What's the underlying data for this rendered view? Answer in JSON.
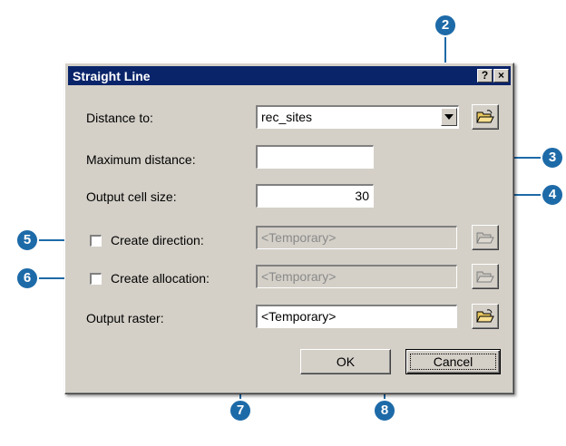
{
  "dialog": {
    "title": "Straight Line",
    "help_button": "?",
    "close_button": "×"
  },
  "form": {
    "distance_to": {
      "label": "Distance to:",
      "value": "rec_sites"
    },
    "max_distance": {
      "label": "Maximum distance:",
      "value": ""
    },
    "cell_size": {
      "label": "Output cell size:",
      "value": "30"
    },
    "create_direction": {
      "label": "Create direction:",
      "checked": false,
      "value": "<Temporary>"
    },
    "create_allocation": {
      "label": "Create allocation:",
      "checked": false,
      "value": "<Temporary>"
    },
    "output_raster": {
      "label": "Output raster:",
      "value": "<Temporary>"
    }
  },
  "buttons": {
    "ok": "OK",
    "cancel": "Cancel"
  },
  "callouts": [
    "2",
    "3",
    "4",
    "5",
    "6",
    "7",
    "8"
  ],
  "colors": {
    "titlebar": "#0a246a",
    "dialog_face": "#d4d0c8",
    "callout": "#1d6aa8"
  },
  "icons": {
    "folder": "open-folder-icon",
    "dropdown": "triangle-down-icon"
  }
}
